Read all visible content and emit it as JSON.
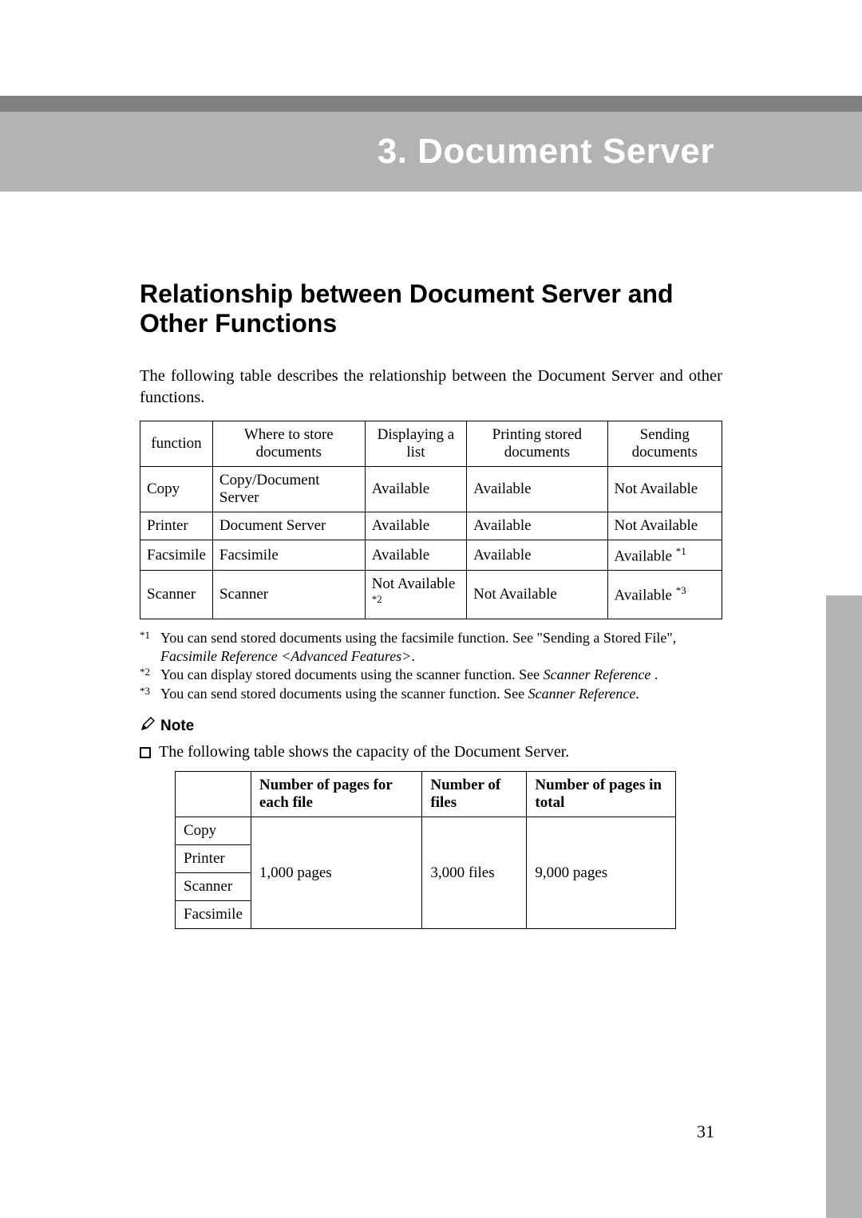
{
  "banner": {
    "title": "3. Document Server"
  },
  "heading": "Relationship between Document Server and Other Functions",
  "intro": "The following table describes the relationship between the Document Server and other functions.",
  "table1": {
    "headers": [
      "function",
      "Where to store documents",
      "Displaying a list",
      "Printing stored documents",
      "Sending documents"
    ],
    "rows": [
      {
        "c0": "Copy",
        "c1": "Copy/Document Server",
        "c2": "Available",
        "c3": "Available",
        "c4": "Not Available"
      },
      {
        "c0": "Printer",
        "c1": "Document Server",
        "c2": "Available",
        "c3": "Available",
        "c4": "Not Available"
      },
      {
        "c0": "Facsimile",
        "c1": "Facsimile",
        "c2": "Available",
        "c3": "Available",
        "c4": "Available ",
        "c4sup": "*1"
      },
      {
        "c0": "Scanner",
        "c1": "Scanner",
        "c2": "Not Available ",
        "c2sup": "*2",
        "c3": "Not Available",
        "c4": "Available ",
        "c4sup": "*3"
      }
    ]
  },
  "footnotes": [
    {
      "sup": "*1",
      "pre": "You can send stored documents using the facsimile function. See \"Sending a Stored File\", ",
      "ital": "Facsimile Reference <Advanced Features>",
      "post": "."
    },
    {
      "sup": "*2",
      "pre": "You can display stored documents using the scanner function. See ",
      "ital": "Scanner Reference",
      "post": " ."
    },
    {
      "sup": "*3",
      "pre": "You can send stored documents using the scanner function. See ",
      "ital": "Scanner Reference",
      "post": "."
    }
  ],
  "note_label": "Note",
  "note_bullet": "The following table shows the capacity of the Document Server.",
  "table2": {
    "headers": [
      "",
      "Number of pages for each file",
      "Number of files",
      "Number of pages in total"
    ],
    "rows": [
      "Copy",
      "Printer",
      "Scanner",
      "Facsimile"
    ],
    "vals": {
      "pages_each": "1,000 pages",
      "files": "3,000 files",
      "pages_total": "9,000 pages"
    }
  },
  "page_number": "31",
  "chart_data": {
    "type": "table",
    "title": "Document Server capacity",
    "columns": [
      "Function",
      "Number of pages for each file",
      "Number of files",
      "Number of pages in total"
    ],
    "rows": [
      [
        "Copy",
        1000,
        3000,
        9000
      ],
      [
        "Printer",
        1000,
        3000,
        9000
      ],
      [
        "Scanner",
        1000,
        3000,
        9000
      ],
      [
        "Facsimile",
        1000,
        3000,
        9000
      ]
    ]
  }
}
